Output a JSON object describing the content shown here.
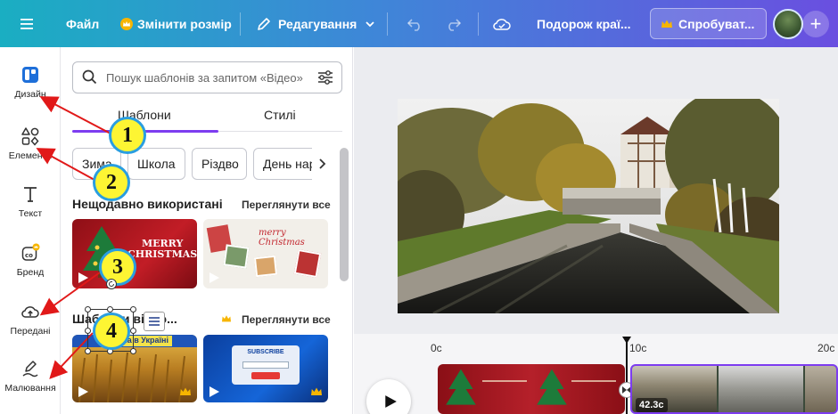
{
  "topbar": {
    "menu_icon": "hamburger-icon",
    "file": "Файл",
    "resize": "Змінити розмір",
    "editing": "Редагування",
    "project_title": "Подорож краї...",
    "try_button": "Спробуват...",
    "accent_colors": [
      "#1aaec2",
      "#6a4fe0"
    ]
  },
  "rail": {
    "items": [
      {
        "label": "Дизайн",
        "icon": "design-icon"
      },
      {
        "label": "Елементи",
        "icon": "elements-icon"
      },
      {
        "label": "Текст",
        "icon": "text-icon"
      },
      {
        "label": "Бренд",
        "icon": "brand-icon"
      },
      {
        "label": "Передані",
        "icon": "upload-cloud-icon"
      },
      {
        "label": "Малювання",
        "icon": "draw-icon"
      }
    ]
  },
  "panel": {
    "search_placeholder": "Пошук шаблонів за запитом «Відео»",
    "tabs": [
      "Шаблони",
      "Стилі"
    ],
    "chips": [
      "Зима",
      "Школа",
      "Різдво",
      "День народження"
    ],
    "recent": {
      "title": "Нещодавно використані",
      "see_all": "Переглянути все",
      "thumb1": {
        "line1": "MERRY",
        "line2": "CHRISTMAS"
      },
      "thumb2": {
        "line1": "merry",
        "line2": "Christmas"
      }
    },
    "templates": {
      "title": "Шаблони відео...",
      "see_all": "Переглянути все",
      "thumb3": {
        "banner": "Зима в Україні"
      },
      "thumb4": {
        "title": "SUBSCRIBE"
      }
    }
  },
  "timeline": {
    "ticks": [
      "0с",
      "10с",
      "20с"
    ],
    "clip_label": "42.3с"
  },
  "annotations": [
    "1",
    "2",
    "3",
    "4"
  ]
}
